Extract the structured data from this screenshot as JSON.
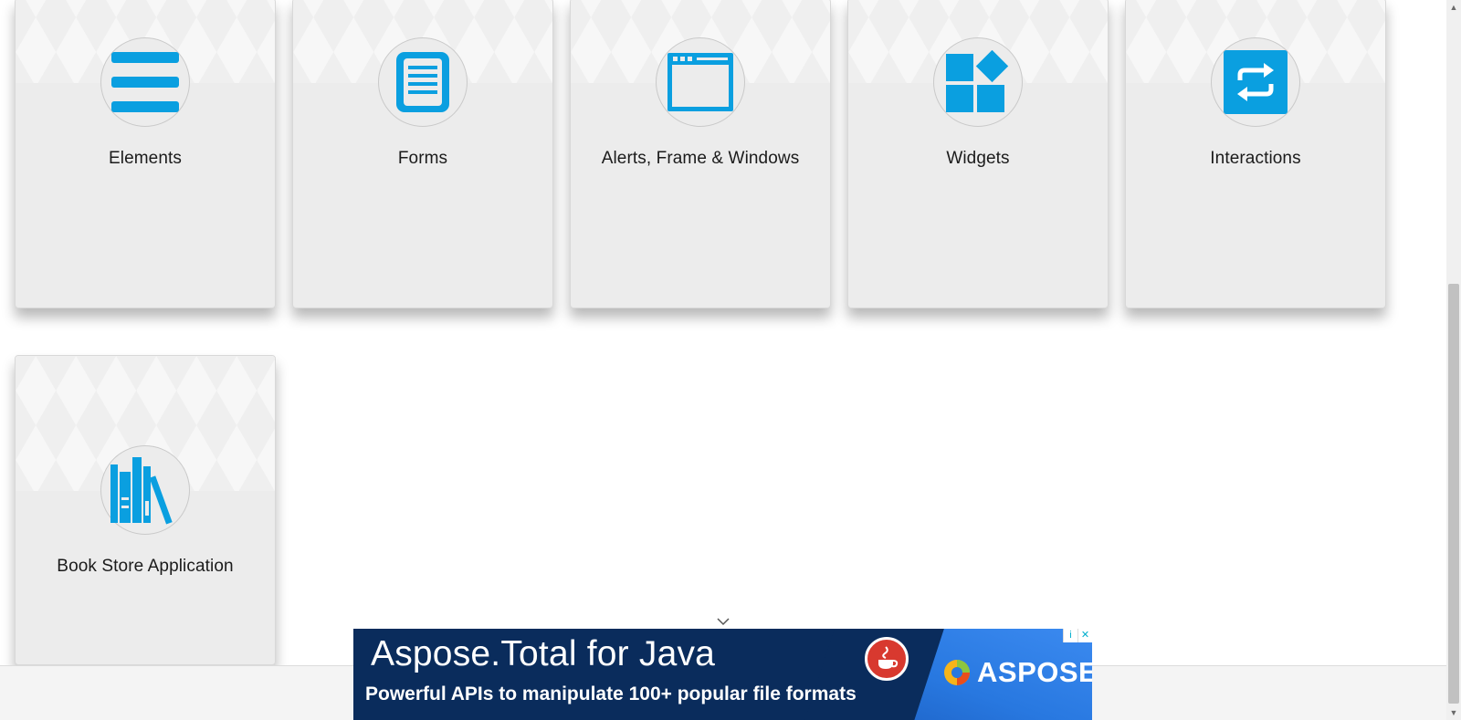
{
  "cards": [
    {
      "title": "Elements",
      "icon": "hamburger-list-icon"
    },
    {
      "title": "Forms",
      "icon": "document-form-icon"
    },
    {
      "title": "Alerts, Frame & Windows",
      "icon": "browser-window-icon"
    },
    {
      "title": "Widgets",
      "icon": "widgets-blocks-icon"
    },
    {
      "title": "Interactions",
      "icon": "repeat-arrows-icon"
    },
    {
      "title": "Book Store Application",
      "icon": "books-icon"
    }
  ],
  "ad": {
    "title": "Aspose.Total for Java",
    "subtitle": "Powerful APIs to manipulate 100+ popular file formats",
    "brand": "ASPOSE",
    "info_label": "i",
    "close_label": "✕"
  },
  "colors": {
    "icon_blue": "#0a9fe0",
    "card_bg": "#ececec",
    "ad_navy": "#0a2c5c",
    "ad_blue": "#3b8af0"
  }
}
